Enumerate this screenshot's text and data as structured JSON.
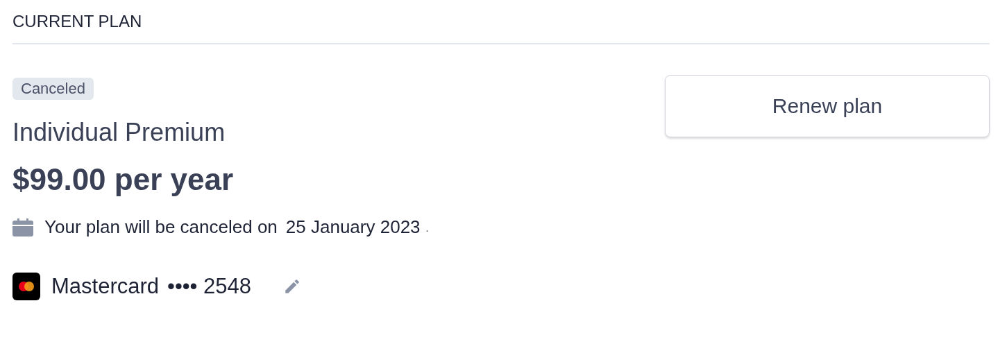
{
  "section_title": "CURRENT PLAN",
  "status_badge": "Canceled",
  "plan_name": "Individual Premium",
  "price": "$99.00 per year",
  "cancel_notice": {
    "text": "Your plan will be canceled on",
    "date": "25 January 2023",
    "end": "."
  },
  "payment_method": {
    "brand": "Mastercard",
    "masked": "•••• 2548"
  },
  "renew_button": "Renew plan"
}
